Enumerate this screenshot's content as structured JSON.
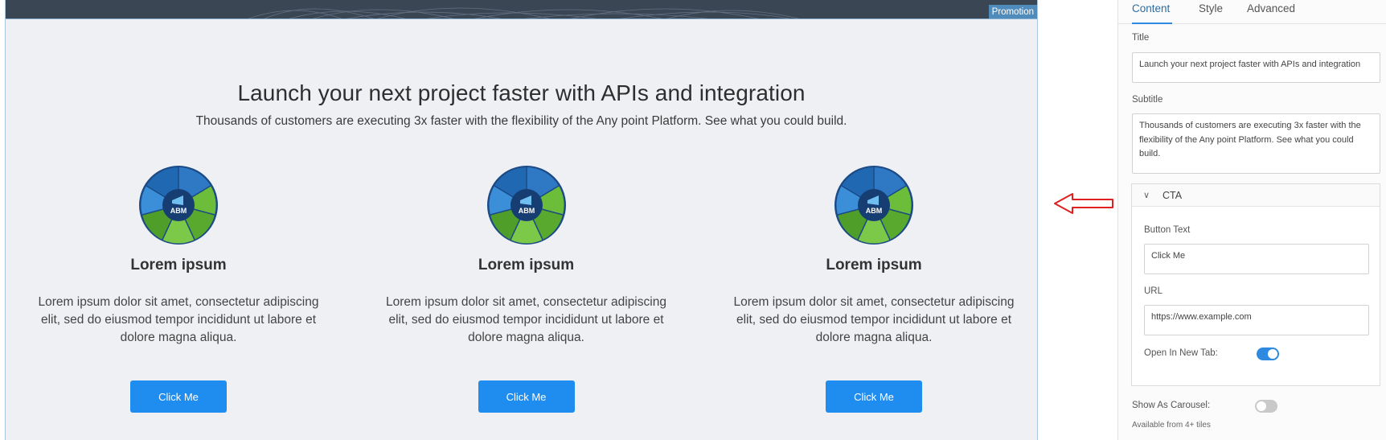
{
  "preview": {
    "promo_tag": "Promotion",
    "title": "Launch your next project faster with APIs and integration",
    "subtitle": "Thousands of customers are executing 3x faster with the flexibility of the Any point Platform. See what you could build.",
    "tiles": [
      {
        "image_label": "ABM",
        "title": "Lorem ipsum",
        "description": "Lorem ipsum dolor sit amet, consectetur adipiscing elit, sed do eiusmod tempor incididunt ut labore et dolore magna aliqua.",
        "button": "Click Me"
      },
      {
        "image_label": "ABM",
        "title": "Lorem ipsum",
        "description": "Lorem ipsum dolor sit amet, consectetur adipiscing elit, sed do eiusmod tempor incididunt ut labore et dolore magna aliqua.",
        "button": "Click Me"
      },
      {
        "image_label": "ABM",
        "title": "Lorem ipsum",
        "description": "Lorem ipsum dolor sit amet, consectetur adipiscing elit, sed do eiusmod tempor incididunt ut labore et dolore magna aliqua.",
        "button": "Click Me"
      }
    ]
  },
  "panel": {
    "tabs": [
      {
        "label": "Content",
        "active": true
      },
      {
        "label": "Style",
        "active": false
      },
      {
        "label": "Advanced",
        "active": false
      }
    ],
    "title_label": "Title",
    "title_value": "Launch your next project faster with APIs and integration",
    "subtitle_label": "Subtitle",
    "subtitle_value": "Thousands of customers are executing 3x faster with the flexibility of the Any point Platform. See what you could build.",
    "cta": {
      "section_label": "CTA",
      "button_text_label": "Button Text",
      "button_text_value": "Click Me",
      "url_label": "URL",
      "url_value": "https://www.example.com",
      "new_tab_label": "Open In New Tab:",
      "new_tab_on": true
    },
    "carousel_label": "Show As Carousel:",
    "carousel_on": false,
    "carousel_hint": "Available from 4+ tiles"
  },
  "colors": {
    "accent": "#1f8cf0",
    "canvas_bg": "#eef0f4",
    "annotation_arrow": "#e02020"
  },
  "icons": [
    "chevron-down-icon",
    "toggle-switch-icon",
    "arrow-left-icon"
  ]
}
